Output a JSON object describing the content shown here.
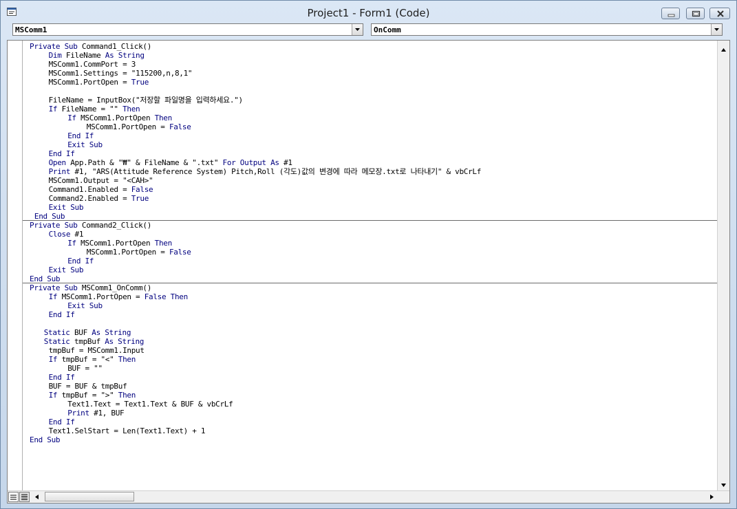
{
  "window": {
    "title": "Project1 - Form1 (Code)"
  },
  "toolbar": {
    "object_combo": "MSComm1",
    "procedure_combo": "OnComm"
  },
  "code": {
    "lines": [
      {
        "indent": 0,
        "parts": [
          [
            "k",
            "Private Sub "
          ],
          [
            "t",
            "Command1_Click()"
          ]
        ]
      },
      {
        "indent": 4,
        "parts": [
          [
            "k",
            "Dim "
          ],
          [
            "t",
            "FileName "
          ],
          [
            "k",
            "As String"
          ]
        ]
      },
      {
        "indent": 4,
        "parts": [
          [
            "t",
            "MSComm1.CommPort = 3"
          ]
        ]
      },
      {
        "indent": 4,
        "parts": [
          [
            "t",
            "MSComm1.Settings = \"115200,n,8,1\""
          ]
        ]
      },
      {
        "indent": 4,
        "parts": [
          [
            "t",
            "MSComm1.PortOpen = "
          ],
          [
            "k",
            "True"
          ]
        ]
      },
      {
        "indent": 0,
        "parts": []
      },
      {
        "indent": 4,
        "parts": [
          [
            "t",
            "FileName = InputBox(\"저장할 파일명을 입력하세요.\")"
          ]
        ]
      },
      {
        "indent": 4,
        "parts": [
          [
            "k",
            "If "
          ],
          [
            "t",
            "FileName = \"\" "
          ],
          [
            "k",
            "Then"
          ]
        ]
      },
      {
        "indent": 8,
        "parts": [
          [
            "k",
            "If "
          ],
          [
            "t",
            "MSComm1.PortOpen "
          ],
          [
            "k",
            "Then"
          ]
        ]
      },
      {
        "indent": 12,
        "parts": [
          [
            "t",
            "MSComm1.PortOpen = "
          ],
          [
            "k",
            "False"
          ]
        ]
      },
      {
        "indent": 8,
        "parts": [
          [
            "k",
            "End If"
          ]
        ]
      },
      {
        "indent": 8,
        "parts": [
          [
            "k",
            "Exit Sub"
          ]
        ]
      },
      {
        "indent": 4,
        "parts": [
          [
            "k",
            "End If"
          ]
        ]
      },
      {
        "indent": 4,
        "parts": [
          [
            "k",
            "Open "
          ],
          [
            "t",
            "App.Path & \"₩\" & FileName & \".txt\" "
          ],
          [
            "k",
            "For Output As "
          ],
          [
            "t",
            "#1"
          ]
        ]
      },
      {
        "indent": 4,
        "parts": [
          [
            "k",
            "Print "
          ],
          [
            "t",
            "#1, \"ARS(Attitude Reference System) Pitch,Roll (각도)값의 변경에 따라 메모장.txt로 나타내기\" & vbCrLf"
          ]
        ]
      },
      {
        "indent": 4,
        "parts": [
          [
            "t",
            "MSComm1.Output = \"<CAH>\""
          ]
        ]
      },
      {
        "indent": 4,
        "parts": [
          [
            "t",
            "Command1.Enabled = "
          ],
          [
            "k",
            "False"
          ]
        ]
      },
      {
        "indent": 4,
        "parts": [
          [
            "t",
            "Command2.Enabled = "
          ],
          [
            "k",
            "True"
          ]
        ]
      },
      {
        "indent": 4,
        "parts": [
          [
            "k",
            "Exit Sub"
          ]
        ]
      },
      {
        "indent": 1,
        "parts": [
          [
            "k",
            "End Sub"
          ]
        ]
      },
      {
        "indent": 0,
        "parts": [
          [
            "k",
            "Private Sub "
          ],
          [
            "t",
            "Command2_Click()"
          ]
        ]
      },
      {
        "indent": 4,
        "parts": [
          [
            "k",
            "Close "
          ],
          [
            "t",
            "#1"
          ]
        ]
      },
      {
        "indent": 8,
        "parts": [
          [
            "k",
            "If "
          ],
          [
            "t",
            "MSComm1.PortOpen "
          ],
          [
            "k",
            "Then"
          ]
        ]
      },
      {
        "indent": 12,
        "parts": [
          [
            "t",
            "MSComm1.PortOpen = "
          ],
          [
            "k",
            "False"
          ]
        ]
      },
      {
        "indent": 8,
        "parts": [
          [
            "k",
            "End If"
          ]
        ]
      },
      {
        "indent": 4,
        "parts": [
          [
            "k",
            "Exit Sub"
          ]
        ]
      },
      {
        "indent": 0,
        "parts": [
          [
            "k",
            "End Sub"
          ]
        ]
      },
      {
        "indent": 0,
        "parts": [
          [
            "k",
            "Private Sub "
          ],
          [
            "t",
            "MSComm1_OnComm()"
          ]
        ]
      },
      {
        "indent": 4,
        "parts": [
          [
            "k",
            "If "
          ],
          [
            "t",
            "MSComm1.PortOpen = "
          ],
          [
            "k",
            "False Then"
          ]
        ]
      },
      {
        "indent": 8,
        "parts": [
          [
            "k",
            "Exit Sub"
          ]
        ]
      },
      {
        "indent": 4,
        "parts": [
          [
            "k",
            "End If"
          ]
        ]
      },
      {
        "indent": 0,
        "parts": []
      },
      {
        "indent": 3,
        "parts": [
          [
            "k",
            "Static "
          ],
          [
            "t",
            "BUF "
          ],
          [
            "k",
            "As String"
          ]
        ]
      },
      {
        "indent": 3,
        "parts": [
          [
            "k",
            "Static "
          ],
          [
            "t",
            "tmpBuf "
          ],
          [
            "k",
            "As String"
          ]
        ]
      },
      {
        "indent": 4,
        "parts": [
          [
            "t",
            "tmpBuf = MSComm1.Input"
          ]
        ]
      },
      {
        "indent": 4,
        "parts": [
          [
            "k",
            "If "
          ],
          [
            "t",
            "tmpBuf = \"<\" "
          ],
          [
            "k",
            "Then"
          ]
        ]
      },
      {
        "indent": 8,
        "parts": [
          [
            "t",
            "BUF = \"\""
          ]
        ]
      },
      {
        "indent": 4,
        "parts": [
          [
            "k",
            "End If"
          ]
        ]
      },
      {
        "indent": 4,
        "parts": [
          [
            "t",
            "BUF = BUF & tmpBuf"
          ]
        ]
      },
      {
        "indent": 4,
        "parts": [
          [
            "k",
            "If "
          ],
          [
            "t",
            "tmpBuf = \">\" "
          ],
          [
            "k",
            "Then"
          ]
        ]
      },
      {
        "indent": 8,
        "parts": [
          [
            "t",
            "Text1.Text = Text1.Text & BUF & vbCrLf"
          ]
        ]
      },
      {
        "indent": 8,
        "parts": [
          [
            "k",
            "Print "
          ],
          [
            "t",
            "#1, BUF"
          ]
        ]
      },
      {
        "indent": 4,
        "parts": [
          [
            "k",
            "End If"
          ]
        ]
      },
      {
        "indent": 4,
        "parts": [
          [
            "t",
            "Text1.SelStart = Len(Text1.Text) + 1"
          ]
        ]
      },
      {
        "indent": 0,
        "parts": [
          [
            "k",
            "End Sub"
          ]
        ]
      }
    ],
    "separators_after_line": [
      19,
      26
    ]
  },
  "colors": {
    "keyword": "#00007f",
    "text": "#000000"
  },
  "icons": [
    "vb-code-window-icon",
    "minimize-icon",
    "restore-icon",
    "close-icon",
    "chevron-down-icon",
    "arrow-up-icon",
    "arrow-down-icon",
    "arrow-left-icon",
    "arrow-right-icon",
    "procedure-view-icon",
    "full-module-view-icon"
  ]
}
